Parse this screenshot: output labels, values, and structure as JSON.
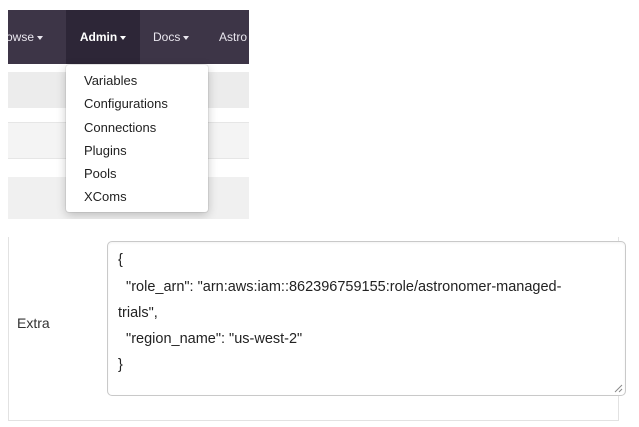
{
  "navbar": {
    "items": [
      {
        "label": "rowse",
        "active": false
      },
      {
        "label": "Admin",
        "active": true
      },
      {
        "label": "Docs",
        "active": false
      },
      {
        "label": "Astro",
        "active": false
      }
    ],
    "color": "#3d3547"
  },
  "admin_menu": {
    "items": [
      "Variables",
      "Configurations",
      "Connections",
      "Plugins",
      "Pools",
      "XComs"
    ]
  },
  "extra_field": {
    "label": "Extra",
    "lines": [
      "{",
      "  \"role_arn\": \"arn:aws:iam::862396759155:role/astronomer-managed-",
      "trials\",",
      "  \"region_name\": \"us-west-2\"",
      "}"
    ]
  },
  "icons": {
    "caret": "caret-down-icon",
    "resize": "resize-grip-icon"
  }
}
